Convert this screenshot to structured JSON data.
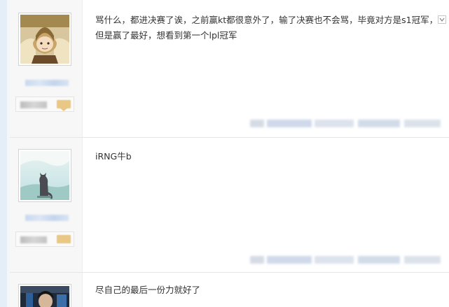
{
  "posts": [
    {
      "text": "骂什么，都进决赛了诶，之前赢kt都很意外了，输了决赛也不会骂，毕竟对方是s1冠军，但是赢了最好，想看到第一个lpl冠军"
    },
    {
      "text": "iRNG牛b"
    },
    {
      "text": "尽自己的最后一份力就好了"
    }
  ],
  "colors": {
    "sidebar_bg": "#f7f7f7",
    "badge_gold": "#e9c784",
    "left_strip": "#e3eef8"
  },
  "icons": {
    "post1_avatar": "anime-character-avatar",
    "post2_avatar": "cat-avatar",
    "post3_avatar": "person-photo-avatar",
    "corner": "close-icon"
  }
}
